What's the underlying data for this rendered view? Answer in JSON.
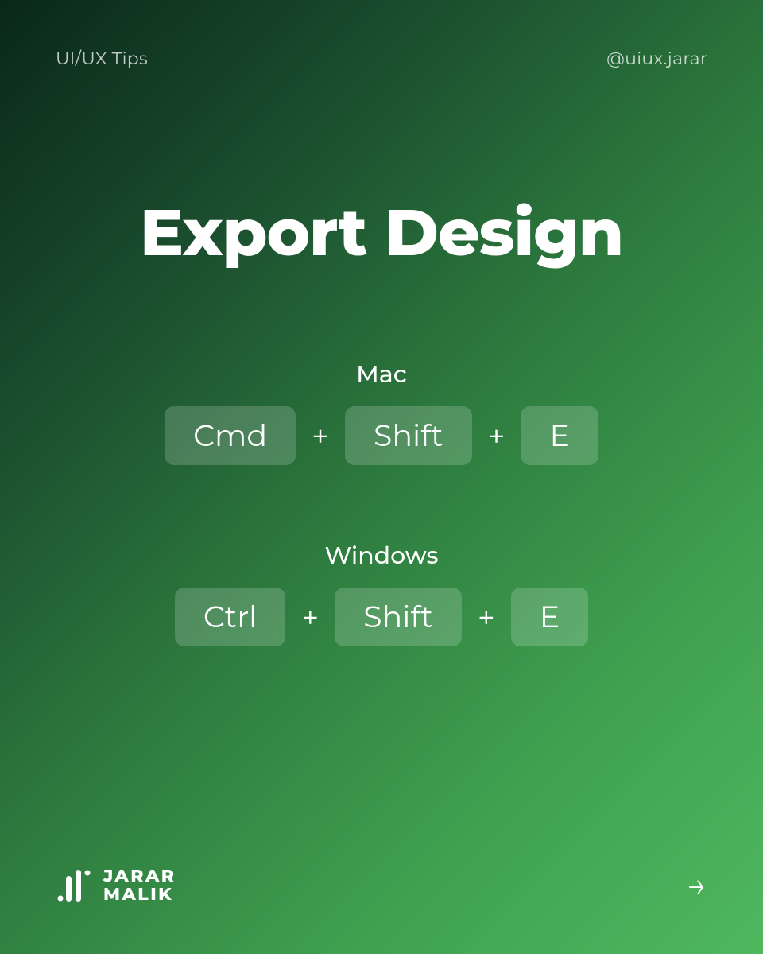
{
  "header": {
    "category": "UI/UX Tips",
    "handle": "@uiux.jarar"
  },
  "title": "Export Design",
  "shortcuts": [
    {
      "platform": "Mac",
      "keys": [
        "Cmd",
        "Shift",
        "E"
      ],
      "separator": "+"
    },
    {
      "platform": "Windows",
      "keys": [
        "Ctrl",
        "Shift",
        "E"
      ],
      "separator": "+"
    }
  ],
  "footer": {
    "logo_line1": "JARAR",
    "logo_line2": "MALIK",
    "arrow": "→"
  }
}
